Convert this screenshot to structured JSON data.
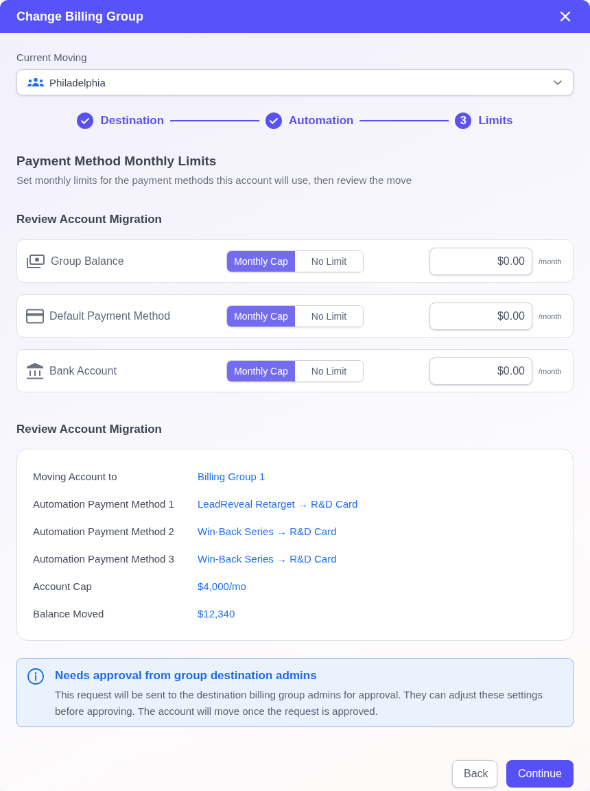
{
  "dialog": {
    "title": "Change Billing Group"
  },
  "current_moving": {
    "label": "Current Moving",
    "value": "Philadelphia"
  },
  "steps": [
    {
      "label": "Destination",
      "completed": true
    },
    {
      "label": "Automation",
      "completed": true
    },
    {
      "label": "Limits",
      "completed": false,
      "number": "3"
    }
  ],
  "limits": {
    "title": "Payment Method Monthly Limits",
    "subtitle": "Set monthly limits for the payment methods this account will use, then review the move",
    "heading": "Review Account Migration",
    "methods": [
      {
        "label": "Group Balance",
        "kind": "cash",
        "options": [
          {
            "label": "Monthly Cap",
            "selected": true
          },
          {
            "label": "No Limit",
            "selected": false
          }
        ],
        "amount": "$0.00",
        "unit": "/month"
      },
      {
        "label": "Default Payment Method",
        "kind": "card",
        "options": [
          {
            "label": "Monthly Cap",
            "selected": true
          },
          {
            "label": "No Limit",
            "selected": false
          }
        ],
        "amount": "$0.00",
        "unit": "/month"
      },
      {
        "label": "Bank Account",
        "kind": "bank",
        "options": [
          {
            "label": "Monthly Cap",
            "selected": true
          },
          {
            "label": "No Limit",
            "selected": false
          }
        ],
        "amount": "$0.00",
        "unit": "/month"
      }
    ]
  },
  "review": {
    "heading": "Review Account Migration",
    "rows": [
      {
        "label": "Moving Account to",
        "value": "Billing Group 1"
      },
      {
        "label": "Automation Payment Method 1",
        "value": "LeadReveal Retarget → R&D Card"
      },
      {
        "label": "Automation Payment Method 2",
        "value": "Win-Back Series → R&D Card"
      },
      {
        "label": "Automation Payment Method 3",
        "value": "Win-Back Series → R&D Card"
      },
      {
        "label": "Account Cap",
        "value": "$4,000/mo"
      },
      {
        "label": "Balance Moved",
        "value": "$12,340"
      }
    ]
  },
  "notice": {
    "title": "Needs approval from group destination admins",
    "text": "This request will be sent to the destination billing group admins for approval. They can adjust these settings before approving. The account will move once the request is approved."
  },
  "buttons": [
    {
      "label": "Back",
      "kind": "secondary"
    },
    {
      "label": "Continue",
      "kind": "primary"
    }
  ]
}
